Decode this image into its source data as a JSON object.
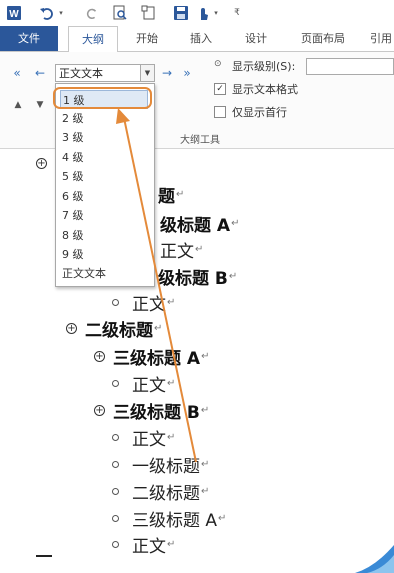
{
  "quick_access": {
    "word_icon": "word-app-icon",
    "undo_icon": "undo-icon",
    "redo_icon": "redo-icon",
    "print_preview_icon": "print-preview-icon",
    "new_doc_icon": "new-document-icon",
    "save_icon": "save-icon",
    "touch_icon": "touch-mode-icon",
    "customize_icon": "customize-icon"
  },
  "tabs": [
    {
      "label": "文件"
    },
    {
      "label": "大纲"
    },
    {
      "label": "开始"
    },
    {
      "label": "插入"
    },
    {
      "label": "设计"
    },
    {
      "label": "页面布局"
    },
    {
      "label": "引用"
    }
  ],
  "ribbon": {
    "level_select_value": "正文文本",
    "show_level_label": "显示级别(S):",
    "show_text_format_label": "显示文本格式",
    "show_first_line_label": "仅显示首行",
    "group_label": "大纲工具",
    "dropdown_items": [
      "1 级",
      "2 级",
      "3 级",
      "4 级",
      "5 级",
      "6 级",
      "7 级",
      "8 级",
      "9 级",
      "正文文本"
    ]
  },
  "document": {
    "lines": [
      {
        "text": "题",
        "mark": "↵"
      },
      {
        "text": "级标题 A",
        "mark": "↵"
      },
      {
        "text": "正文",
        "mark": "↵"
      },
      {
        "text": "级标题 B",
        "mark": "↵"
      },
      {
        "text": "正文",
        "mark": "↵"
      },
      {
        "text": "二级标题",
        "mark": "↵"
      },
      {
        "text": "三级标题 A",
        "mark": "↵"
      },
      {
        "text": "正文",
        "mark": "↵"
      },
      {
        "text": "三级标题 B",
        "mark": "↵"
      },
      {
        "text": "正文",
        "mark": "↵"
      },
      {
        "text": "一级标题",
        "mark": "↵"
      },
      {
        "text": "二级标题",
        "mark": "↵"
      },
      {
        "text": "三级标题 A",
        "mark": "↵"
      },
      {
        "text": "正文",
        "mark": "↵"
      }
    ],
    "expand_symbol": "+"
  },
  "colors": {
    "accent": "#2b579a",
    "annotation": "#e48a3a"
  }
}
